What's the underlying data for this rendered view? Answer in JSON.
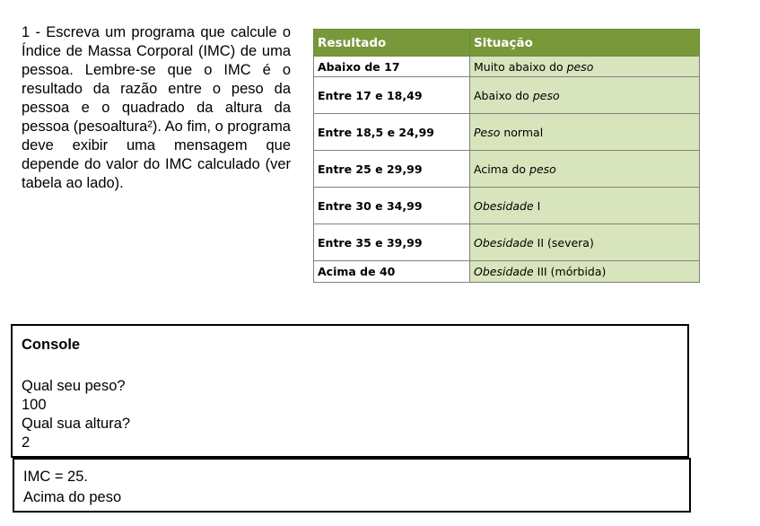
{
  "exercise": {
    "text": "1 - Escreva um programa que calcule o Índice de Massa Corporal (IMC) de uma pessoa. Lembre-se que o IMC é o resultado da razão entre o peso da pessoa e o quadrado da altura da pessoa (pesoaltura²). Ao fim, o programa deve exibir uma mensagem que depende do valor do IMC calculado (ver tabela ao lado)."
  },
  "table": {
    "headers": [
      "Resultado",
      "Situação"
    ],
    "rows": [
      {
        "resultado": "Abaixo de 17",
        "situacao_pre": "Muito abaixo do ",
        "situacao_em": "peso",
        "situacao_post": ""
      },
      {
        "resultado": "Entre 17 e 18,49",
        "situacao_pre": "Abaixo do ",
        "situacao_em": "peso",
        "situacao_post": ""
      },
      {
        "resultado": "Entre 18,5 e 24,99",
        "situacao_pre": "",
        "situacao_em": "Peso",
        "situacao_post": " normal"
      },
      {
        "resultado": "Entre 25 e 29,99",
        "situacao_pre": "Acima do ",
        "situacao_em": "peso",
        "situacao_post": ""
      },
      {
        "resultado": "Entre 30 e 34,99",
        "situacao_pre": "",
        "situacao_em": "Obesidade",
        "situacao_post": " I"
      },
      {
        "resultado": "Entre 35 e 39,99",
        "situacao_pre": "",
        "situacao_em": "Obesidade",
        "situacao_post": " II (severa)"
      },
      {
        "resultado": "Acima de 40",
        "situacao_pre": "",
        "situacao_em": "Obesidade",
        "situacao_post": " III (mórbida)"
      }
    ]
  },
  "console": {
    "title": "Console",
    "lines": [
      "Qual seu peso?",
      "100",
      "Qual sua altura?",
      "2"
    ]
  },
  "result": {
    "lines": [
      "IMC = 25.",
      "Acima do peso"
    ]
  }
}
